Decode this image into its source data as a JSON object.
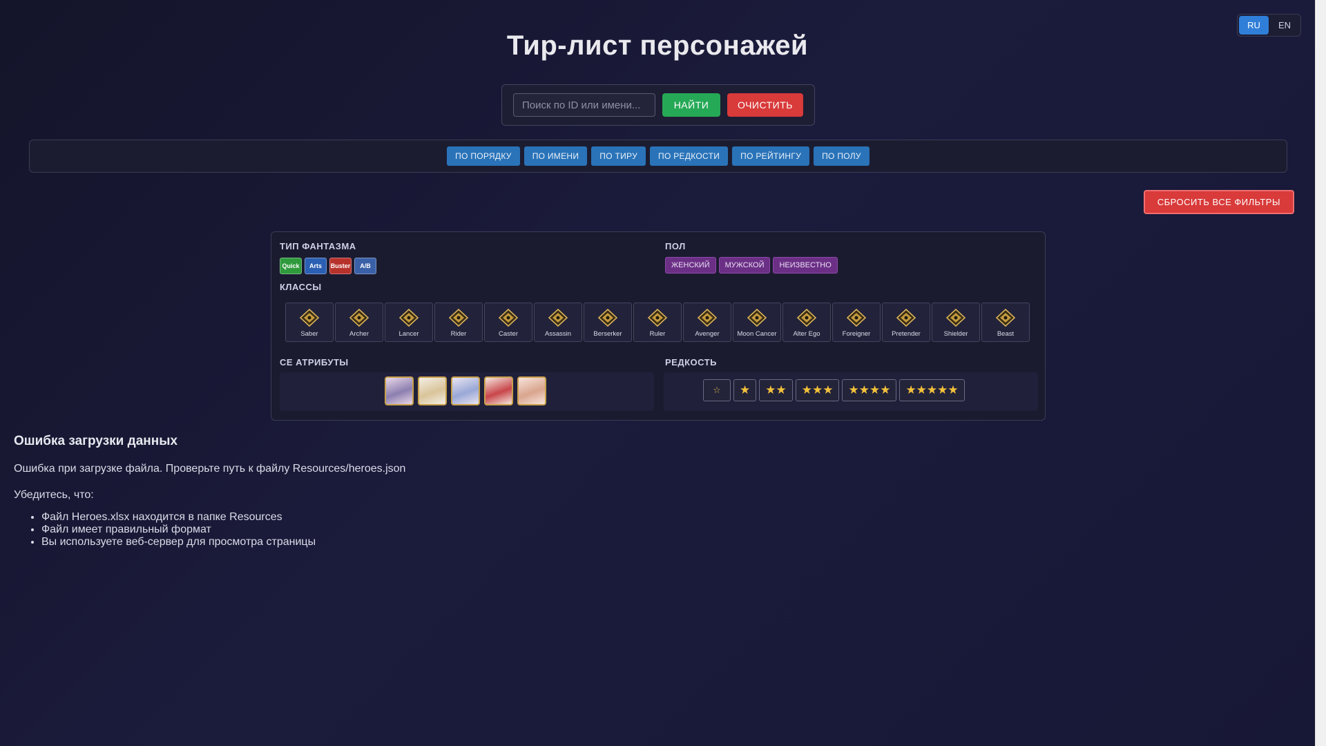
{
  "language": {
    "ru": "RU",
    "en": "EN",
    "active": "RU"
  },
  "header": {
    "title": "Тир-лист персонажей"
  },
  "search": {
    "placeholder": "Поиск по ID или имени...",
    "value": "",
    "find_label": "НАЙТИ",
    "clear_label": "ОЧИСТИТЬ"
  },
  "sort": {
    "buttons": [
      "ПО ПОРЯДКУ",
      "ПО ИМЕНИ",
      "ПО ТИРУ",
      "ПО РЕДКОСТИ",
      "ПО РЕЙТИНГУ",
      "ПО ПОЛУ"
    ]
  },
  "reset_label": "СБРОСИТЬ ВСЕ ФИЛЬТРЫ",
  "filters": {
    "np_label": "ТИП ФАНТАЗМА",
    "np_types": [
      {
        "label": "Quick",
        "color": "#2f9a3c"
      },
      {
        "label": "Arts",
        "color": "#2b5fb3"
      },
      {
        "label": "Buster",
        "color": "#b8322c"
      },
      {
        "label": "A/B",
        "color": "#3a60a8"
      }
    ],
    "gender_label": "ПОЛ",
    "genders": [
      "ЖЕНСКИЙ",
      "МУЖСКОЙ",
      "НЕИЗВЕСТНО"
    ],
    "classes_label": "КЛАССЫ",
    "classes": [
      "Saber",
      "Archer",
      "Lancer",
      "Rider",
      "Caster",
      "Assassin",
      "Berserker",
      "Ruler",
      "Avenger",
      "Moon Cancer",
      "Alter Ego",
      "Foreigner",
      "Pretender",
      "Shielder",
      "Beast"
    ],
    "ce_label": "СЕ АТРИБУТЫ",
    "ce_cards": [
      {
        "name": "ce-card-1",
        "color_a": "#8c7fb0",
        "color_b": "#e9d7e8"
      },
      {
        "name": "ce-card-2",
        "color_a": "#d9c49a",
        "color_b": "#f3eee5"
      },
      {
        "name": "ce-card-3",
        "color_a": "#9aa8d6",
        "color_b": "#e8e4f2"
      },
      {
        "name": "ce-card-4",
        "color_a": "#c8454a",
        "color_b": "#f4e6dc"
      },
      {
        "name": "ce-card-5",
        "color_a": "#d9a58e",
        "color_b": "#f7e4dc"
      }
    ],
    "rarity_label": "РЕДКОСТЬ",
    "rarities": [
      "☆",
      "★",
      "★★",
      "★★★",
      "★★★★",
      "★★★★★"
    ]
  },
  "error": {
    "title": "Ошибка загрузки данных",
    "message": "Ошибка при загрузке файла. Проверьте путь к файлу Resources/heroes.json",
    "subtitle": "Убедитесь, что:",
    "items": [
      "Файл Heroes.xlsx находится в папке Resources",
      "Файл имеет правильный формат",
      "Вы используете веб-сервер для просмотра страницы"
    ]
  }
}
